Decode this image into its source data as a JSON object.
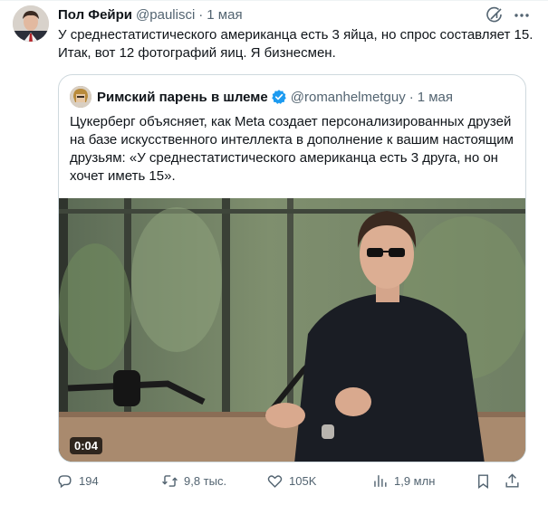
{
  "tweet": {
    "author_name": "Пол Фейри",
    "author_handle": "@paulisci",
    "separator": "·",
    "date": "1 мая",
    "text": "У среднестатистического американца есть 3 яйца, но спрос составляет 15. Итак, вот 12 фотографий яиц. Я бизнесмен."
  },
  "quote": {
    "author_name": "Римский парень в шлеме",
    "author_handle": "@romanhelmetguy",
    "separator": "·",
    "date": "1 мая",
    "text": "Цукерберг объясняет, как Meta создает персонализированных друзей на базе искусственного интеллекта в дополнение к вашим настоящим друзьям: «У среднестатистического американца есть 3 друга, но он хочет иметь 15».",
    "video_time": "0:04"
  },
  "actions": {
    "replies": "194",
    "reposts": "9,8 тыс.",
    "likes": "105K",
    "views": "1,9 млн"
  },
  "colors": {
    "text_primary": "#0f1419",
    "text_secondary": "#536471",
    "border": "#cfd9de",
    "verified": "#1d9bf0"
  },
  "icons": [
    "grok-icon",
    "more-icon",
    "verified-icon",
    "reply-icon",
    "repost-icon",
    "like-icon",
    "views-icon",
    "bookmark-icon",
    "share-icon"
  ]
}
